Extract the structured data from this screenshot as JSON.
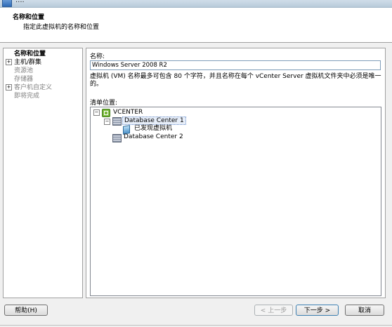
{
  "window": {
    "title": "...."
  },
  "header": {
    "title": "名称和位置",
    "subtitle": "指定此虚拟机的名称和位置"
  },
  "nav": {
    "items": [
      {
        "label": "名称和位置",
        "state": "active",
        "expandable": false
      },
      {
        "label": "主机/群集",
        "state": "normal",
        "expandable": true
      },
      {
        "label": "资源池",
        "state": "inactive",
        "expandable": false
      },
      {
        "label": "存储器",
        "state": "inactive",
        "expandable": false
      },
      {
        "label": "客户机自定义",
        "state": "inactive",
        "expandable": true
      },
      {
        "label": "即将完成",
        "state": "inactive",
        "expandable": false
      }
    ]
  },
  "form": {
    "name_label": "名称:",
    "name_value": "Windows Server 2008 R2",
    "hint": "虚拟机 (VM) 名称最多可包含 80 个字符，并且名称在每个 vCenter Server 虚拟机文件夹中必须是唯一的。",
    "inventory_label": "清单位置:"
  },
  "tree": {
    "root": "VCENTER",
    "datacenter1": "Database Center 1",
    "discovered": "已发现虚拟机",
    "datacenter2": "Database Center 2",
    "expander_expanded": "−"
  },
  "nav_expander_symbol": "+",
  "buttons": {
    "help": "帮助(H)",
    "back": "< 上一步",
    "next": "下一步 >",
    "cancel": "取消"
  }
}
